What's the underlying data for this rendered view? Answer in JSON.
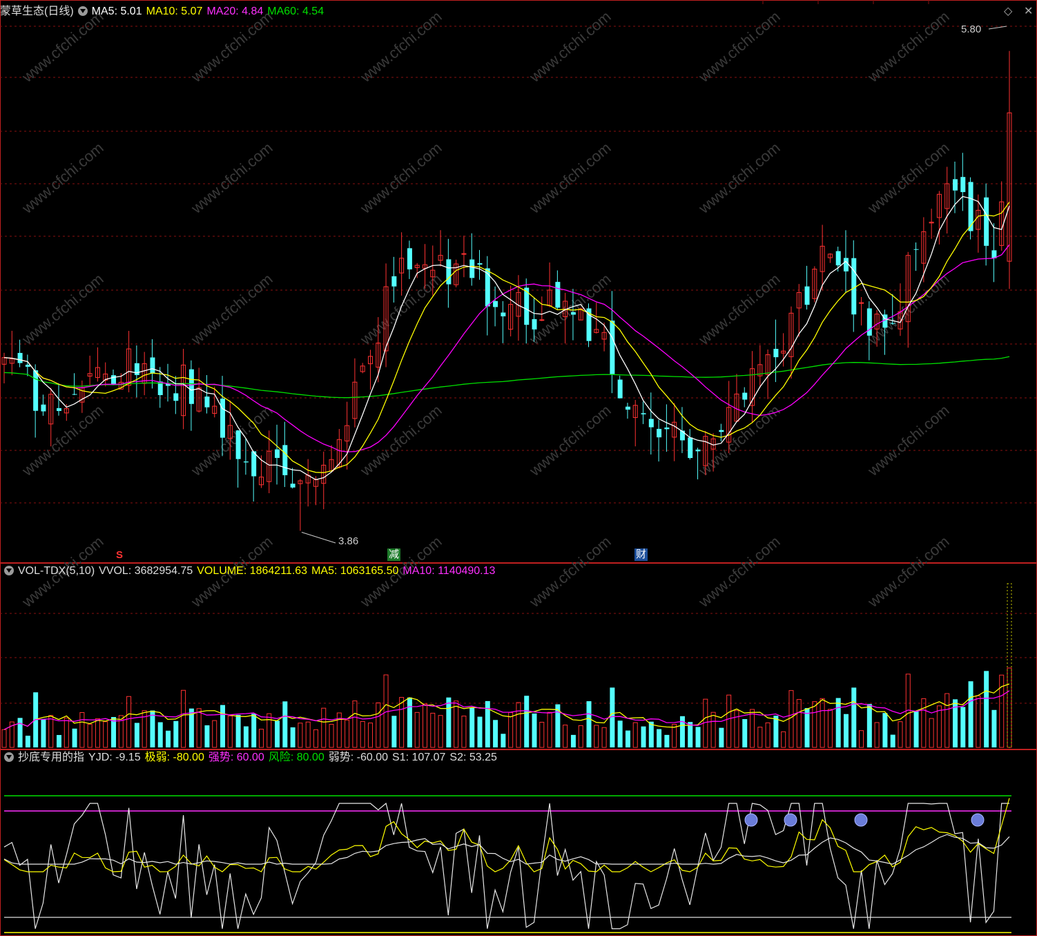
{
  "main_header": {
    "title": "蒙草生态(日线)",
    "ma5": "MA5: 5.01",
    "ma10": "MA10: 5.07",
    "ma20": "MA20: 4.84",
    "ma60": "MA60: 4.54"
  },
  "vol_header": {
    "title": "VOL-TDX(5,10)",
    "vvol": "VVOL: 3682954.75",
    "volume": "VOLUME: 1864211.63",
    "ma5": "MA5: 1063165.50",
    "ma10": "MA10: 1140490.13"
  },
  "ind_header": {
    "title": "抄底专用的指",
    "yjd": "YJD: -9.15",
    "jiruo": "极弱: -80.00",
    "qiangshi": "强势: 60.00",
    "fengxian": "风险: 80.00",
    "ruoshi": "弱势: -60.00",
    "s1": "S1: 107.07",
    "s2": "S2: 53.25"
  },
  "annotations": {
    "high_label": "5.80",
    "low_label": "3.86",
    "marker_s": "S",
    "marker_jian": "减",
    "marker_cai": "财"
  },
  "watermark": "www.cfchi.com",
  "colors": {
    "up": "#ff3232",
    "down": "#54ffff",
    "ma5": "#ffffff",
    "ma10": "#ffff00",
    "ma20": "#ff00ff",
    "ma60": "#00e000",
    "grid": "#8a1010",
    "frame": "#c02020"
  },
  "chart_data": [
    {
      "type": "candlestick",
      "price_range": [
        3.8,
        5.9
      ],
      "high": 5.8,
      "low": 3.86,
      "series": [
        "MA5",
        "MA10",
        "MA20",
        "MA60"
      ],
      "segments": [
        {
          "start": 4.55,
          "end": 4.35,
          "bars": 8
        },
        {
          "start": 4.35,
          "end": 4.55,
          "bars": 8
        },
        {
          "start": 4.55,
          "end": 4.45,
          "bars": 8
        },
        {
          "start": 4.45,
          "end": 4.2,
          "bars": 8
        },
        {
          "start": 4.2,
          "end": 4.0,
          "bars": 6
        },
        {
          "start": 4.0,
          "end": 4.2,
          "bars": 6
        },
        {
          "start": 4.2,
          "end": 4.95,
          "bars": 8
        },
        {
          "start": 4.95,
          "end": 4.9,
          "bars": 8
        },
        {
          "start": 4.9,
          "end": 4.75,
          "bars": 8
        },
        {
          "start": 4.75,
          "end": 4.8,
          "bars": 6
        },
        {
          "start": 4.8,
          "end": 4.35,
          "bars": 8
        },
        {
          "start": 4.35,
          "end": 4.2,
          "bars": 8
        },
        {
          "start": 4.2,
          "end": 4.5,
          "bars": 8
        },
        {
          "start": 4.5,
          "end": 4.95,
          "bars": 8
        },
        {
          "start": 4.95,
          "end": 4.65,
          "bars": 8
        },
        {
          "start": 4.65,
          "end": 5.35,
          "bars": 8
        },
        {
          "start": 5.35,
          "end": 4.95,
          "bars": 6
        },
        {
          "start": 4.95,
          "end": 5.5,
          "bars": 2
        }
      ]
    },
    {
      "type": "bar",
      "name": "VOL-TDX(5,10)",
      "vvol": 3682954.75,
      "volume": 1864211.63,
      "ma5": 1063165.5,
      "ma10": 1140490.13
    },
    {
      "type": "line",
      "name": "抄底专用的指",
      "yjd": -9.15,
      "levels": {
        "极弱": -80.0,
        "强势": 60.0,
        "风险": 80.0,
        "弱势": -60.0
      },
      "s1": 107.07,
      "s2": 53.25
    }
  ]
}
